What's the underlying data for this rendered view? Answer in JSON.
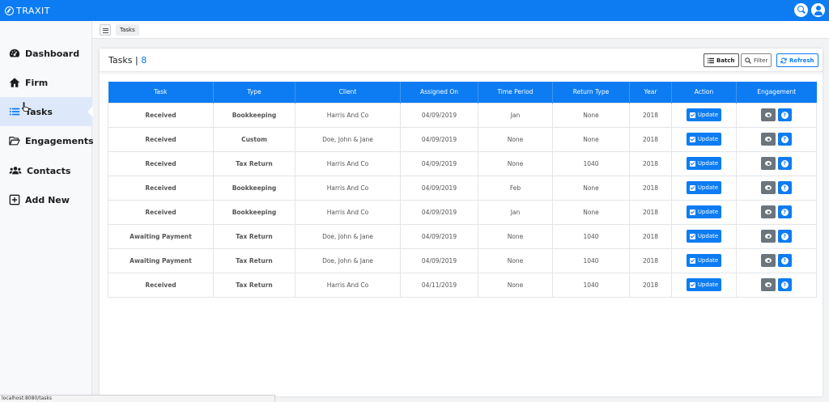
{
  "app": {
    "title": "TRAXIT"
  },
  "sidebar": {
    "items": [
      {
        "label": "Dashboard",
        "icon": "dashboard-icon",
        "active": false
      },
      {
        "label": "Firm",
        "icon": "home-icon",
        "active": false
      },
      {
        "label": "Tasks",
        "icon": "list-icon",
        "active": true
      },
      {
        "label": "Engagements",
        "icon": "folder-open-icon",
        "active": false
      },
      {
        "label": "Contacts",
        "icon": "users-icon",
        "active": false
      },
      {
        "label": "Add New",
        "icon": "plus-square-icon",
        "active": false
      }
    ]
  },
  "breadcrumb": {
    "current": "Tasks"
  },
  "card": {
    "title": "Tasks |",
    "count": "8",
    "buttons": {
      "batch": "Batch",
      "filter": "Filter",
      "refresh": "Refresh"
    }
  },
  "table": {
    "columns": [
      "Task",
      "Type",
      "Client",
      "Assigned On",
      "Time Period",
      "Return Type",
      "Year",
      "Action",
      "Engagement"
    ],
    "action_label": "Update",
    "rows": [
      {
        "task": "Received",
        "type": "Bookkeeping",
        "client": "Harris And Co",
        "assigned_on": "04/09/2019",
        "time_period": "Jan",
        "return_type": "None",
        "year": "2018"
      },
      {
        "task": "Received",
        "type": "Custom",
        "client": "Doe, John & Jane",
        "assigned_on": "04/09/2019",
        "time_period": "None",
        "return_type": "None",
        "year": "2018"
      },
      {
        "task": "Received",
        "type": "Tax Return",
        "client": "Harris And Co",
        "assigned_on": "04/09/2019",
        "time_period": "None",
        "return_type": "1040",
        "year": "2018"
      },
      {
        "task": "Received",
        "type": "Bookkeeping",
        "client": "Harris And Co",
        "assigned_on": "04/09/2019",
        "time_period": "Feb",
        "return_type": "None",
        "year": "2018"
      },
      {
        "task": "Received",
        "type": "Bookkeeping",
        "client": "Harris And Co",
        "assigned_on": "04/09/2019",
        "time_period": "Jan",
        "return_type": "None",
        "year": "2018"
      },
      {
        "task": "Awaiting Payment",
        "type": "Tax Return",
        "client": "Doe, John & Jane",
        "assigned_on": "04/09/2019",
        "time_period": "None",
        "return_type": "1040",
        "year": "2018"
      },
      {
        "task": "Awaiting Payment",
        "type": "Tax Return",
        "client": "Doe, John & Jane",
        "assigned_on": "04/09/2019",
        "time_period": "None",
        "return_type": "1040",
        "year": "2018"
      },
      {
        "task": "Received",
        "type": "Tax Return",
        "client": "Harris And Co",
        "assigned_on": "04/11/2019",
        "time_period": "None",
        "return_type": "1040",
        "year": "2018"
      }
    ]
  },
  "statusbar": {
    "url": "localhost:8080/tasks"
  },
  "colors": {
    "primary": "#0d7cf2",
    "secondary": "#6c757d",
    "sidebar_active": "#dde9fb"
  }
}
